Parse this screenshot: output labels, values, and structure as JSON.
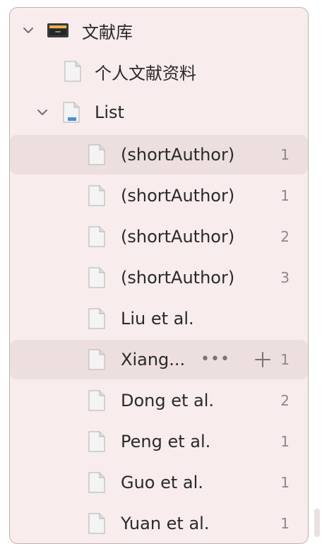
{
  "tree": {
    "library": {
      "label": "文献库",
      "icon": "archive-box-icon"
    },
    "personal": {
      "label": "个人文献资料",
      "icon": "document-icon"
    },
    "list": {
      "label": "List",
      "icon": "folder-document-icon"
    },
    "items": [
      {
        "label": "(shortAuthor)",
        "count": "1"
      },
      {
        "label": "(shortAuthor)",
        "count": "1"
      },
      {
        "label": "(shortAuthor)",
        "count": "2"
      },
      {
        "label": "(shortAuthor)",
        "count": "3"
      },
      {
        "label": "Liu et al.",
        "count": ""
      },
      {
        "label": "Xiang...",
        "count": "1"
      },
      {
        "label": "Dong et al.",
        "count": "2"
      },
      {
        "label": "Peng et al.",
        "count": "1"
      },
      {
        "label": "Guo et al.",
        "count": "1"
      },
      {
        "label": "Yuan et al.",
        "count": "1"
      }
    ]
  },
  "colors": {
    "panel_bg": "#f8ecec",
    "row_highlight": "#ecdfde",
    "count_text": "#8e8888"
  }
}
